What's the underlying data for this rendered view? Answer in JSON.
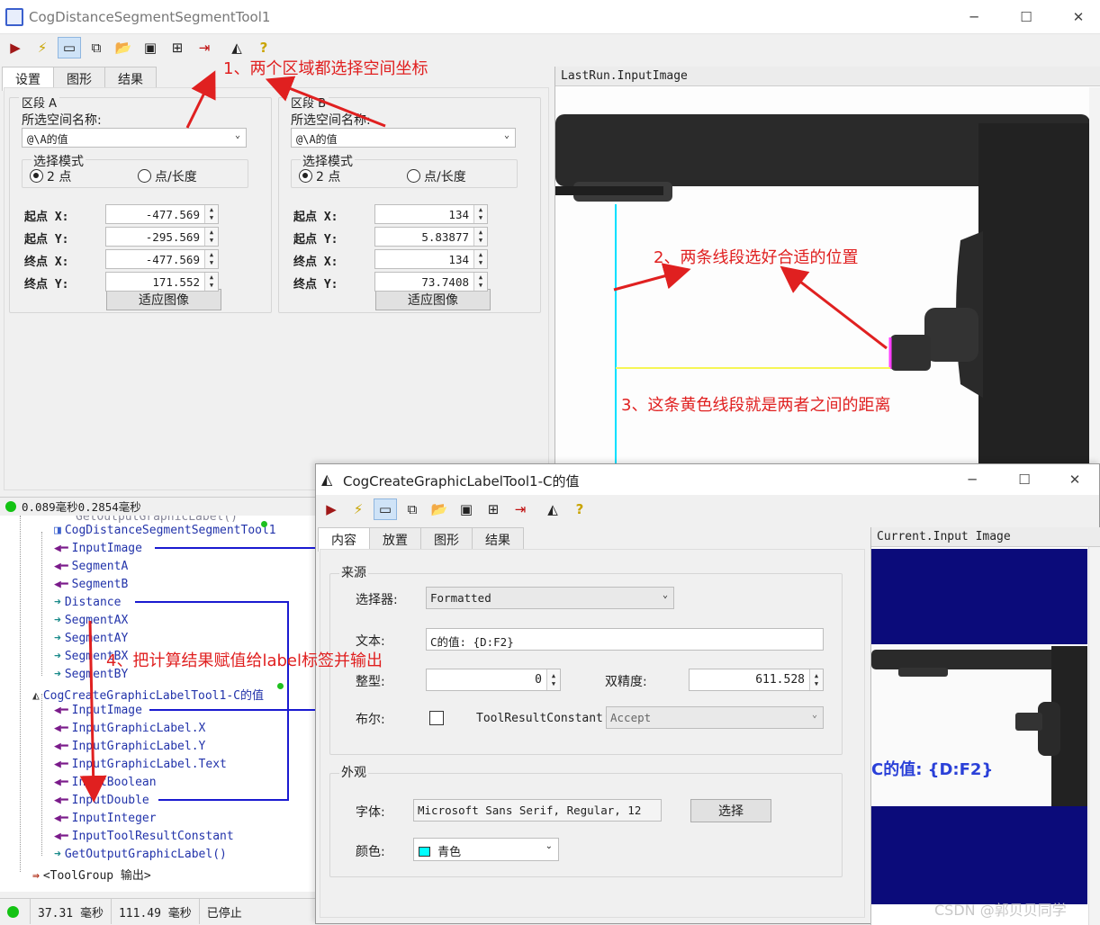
{
  "win1": {
    "title": "CogDistanceSegmentSegmentTool1",
    "controls": [
      "─",
      "☐",
      "✕"
    ]
  },
  "win1_tabs": [
    "设置",
    "图形",
    "结果"
  ],
  "segA": {
    "title": "区段 A",
    "space_label": "所选空间名称:",
    "space_value": "@\\A的值",
    "mode_title": "选择模式",
    "opt1": "2 点",
    "opt2": "点/长度",
    "rows": [
      {
        "label": "起点 X:",
        "value": "-477.569"
      },
      {
        "label": "起点 Y:",
        "value": "-295.569"
      },
      {
        "label": "终点 X:",
        "value": "-477.569"
      },
      {
        "label": "终点 Y:",
        "value": "171.552"
      }
    ],
    "fit": "适应图像"
  },
  "segB": {
    "title": "区段 B",
    "space_label": "所选空间名称:",
    "space_value": "@\\A的值",
    "mode_title": "选择模式",
    "opt1": "2 点",
    "opt2": "点/长度",
    "rows": [
      {
        "label": "起点 X:",
        "value": "134"
      },
      {
        "label": "起点 Y:",
        "value": "5.83877"
      },
      {
        "label": "终点 X:",
        "value": "134"
      },
      {
        "label": "终点 Y:",
        "value": "73.7408"
      }
    ],
    "fit": "适应图像"
  },
  "img1_title": "LastRun.InputImage",
  "status_top": "0.089毫秒0.2854毫秒",
  "tree": {
    "cut": "GetOutputGraphicLabel()",
    "tool1": "CogDistanceSegmentSegmentTool1",
    "tool1_items": [
      "InputImage",
      "SegmentA",
      "SegmentB",
      "Distance",
      "SegmentAX",
      "SegmentAY",
      "SegmentBX",
      "SegmentBY"
    ],
    "tool2": "CogCreateGraphicLabelTool1-C的值",
    "tool2_items": [
      "InputImage",
      "InputGraphicLabel.X",
      "InputGraphicLabel.Y",
      "InputGraphicLabel.Text",
      "InputBoolean",
      "InputDouble",
      "InputInteger",
      "InputToolResultConstant",
      "GetOutputGraphicLabel()"
    ],
    "out": "<ToolGroup 输出>"
  },
  "status_bottom": [
    "37.31 毫秒",
    "111.49 毫秒",
    "已停止"
  ],
  "win2": {
    "title": "CogCreateGraphicLabelTool1-C的值",
    "controls": [
      "─",
      "☐",
      "✕"
    ]
  },
  "win2_tabs": [
    "内容",
    "放置",
    "图形",
    "结果"
  ],
  "source": {
    "title": "来源",
    "selector_label": "选择器:",
    "selector_value": "Formatted",
    "text_label": "文本:",
    "text_value": "C的值: {D:F2}",
    "int_label": "整型:",
    "int_value": "0",
    "double_label": "双精度:",
    "double_value": "611.528",
    "bool_label": "布尔:",
    "trc_label": "ToolResultConstant:",
    "trc_value": "Accept"
  },
  "appearance": {
    "title": "外观",
    "font_label": "字体:",
    "font_value": "Microsoft Sans Serif, Regular, 12",
    "font_btn": "选择",
    "color_label": "颜色:",
    "color_value": "青色",
    "color_hex": "#00ffff"
  },
  "img2_title": "Current.Input Image",
  "img2_label": "C的值: {D:F2}",
  "ann": {
    "a1": "1、两个区域都选择空间坐标",
    "a2": "2、两条线段选好合适的位置",
    "a3": "3、这条黄色线段就是两者之间的距离",
    "a4": "4、把计算结果赋值给label标签并输出"
  },
  "watermark": "CSDN @郭贝贝同学",
  "colors": {
    "red": "#e02020",
    "navy": "#0b0b7a",
    "tree_blue": "#2233aa",
    "purple": "#7a1a8a",
    "teal": "#1a8a8a"
  }
}
